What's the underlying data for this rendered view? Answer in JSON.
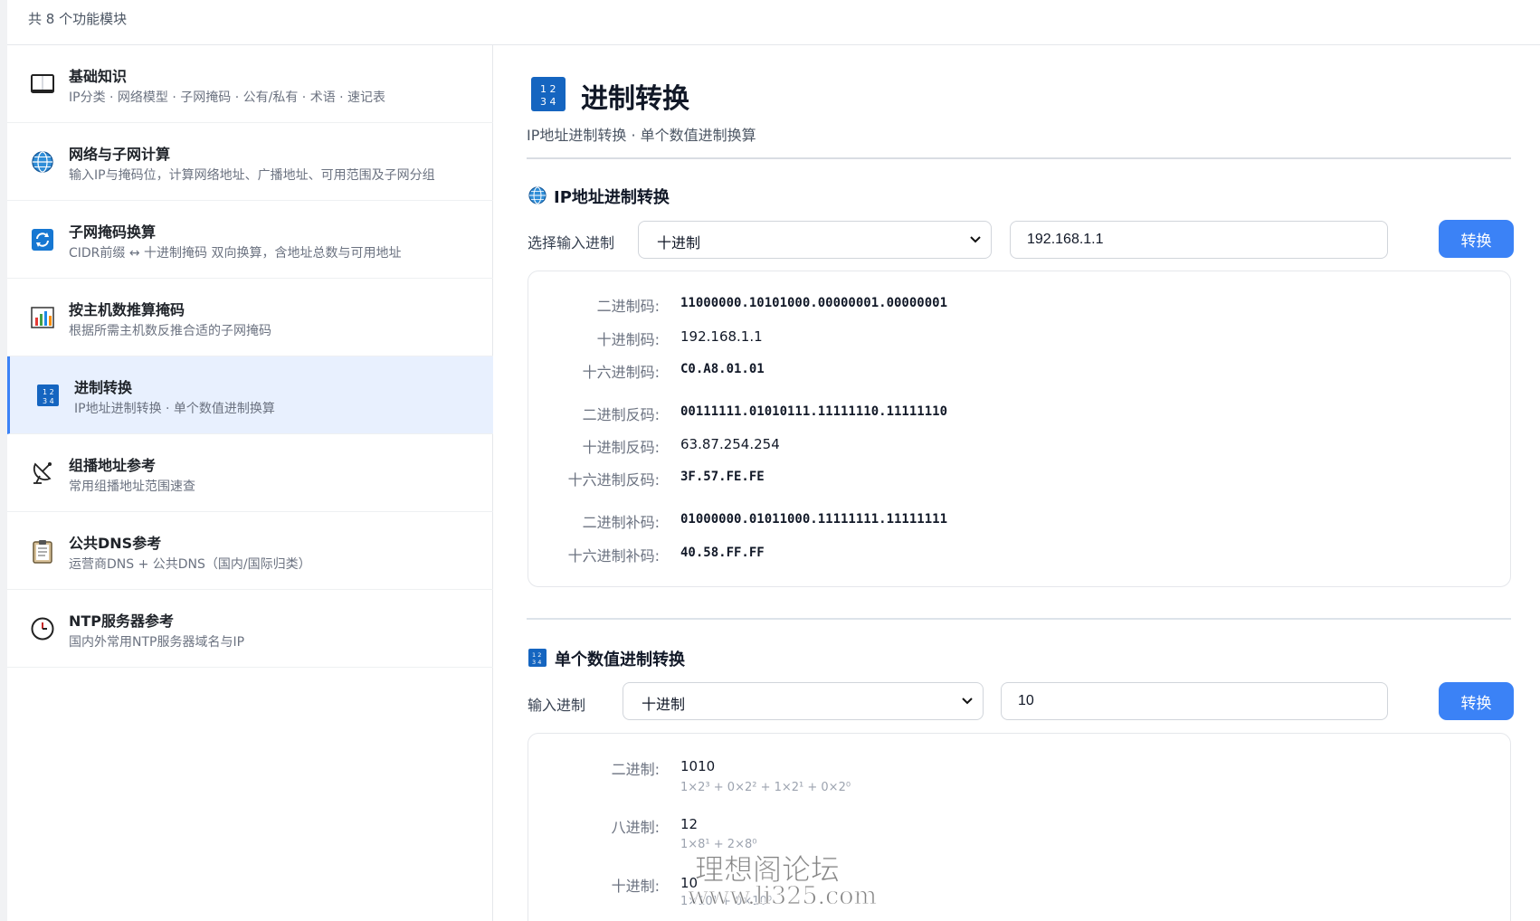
{
  "topbar": {
    "count": "共 8 个功能模块"
  },
  "sidebar": {
    "items": [
      {
        "title": "基础知识",
        "desc": "IP分类 · 网络模型 · 子网掩码 · 公有/私有 · 术语 · 速记表",
        "icon": "book-icon"
      },
      {
        "title": "网络与子网计算",
        "desc": "输入IP与掩码位，计算网络地址、广播地址、可用范围及子网分组",
        "icon": "globe-icon"
      },
      {
        "title": "子网掩码换算",
        "desc": "CIDR前缀 ↔ 十进制掩码 双向换算，含地址总数与可用地址",
        "icon": "refresh-icon"
      },
      {
        "title": "按主机数推算掩码",
        "desc": "根据所需主机数反推合适的子网掩码",
        "icon": "bar-chart-icon"
      },
      {
        "title": "进制转换",
        "desc": "IP地址进制转换 · 单个数值进制换算",
        "icon": "numbers-icon"
      },
      {
        "title": "组播地址参考",
        "desc": "常用组播地址范围速查",
        "icon": "satellite-icon"
      },
      {
        "title": "公共DNS参考",
        "desc": "运营商DNS + 公共DNS（国内/国际归类）",
        "icon": "clipboard-icon"
      },
      {
        "title": "NTP服务器参考",
        "desc": "国内外常用NTP服务器域名与IP",
        "icon": "clock-icon"
      }
    ]
  },
  "main": {
    "title": "进制转换",
    "subtitle": "IP地址进制转换 · 单个数值进制换算",
    "ip_section": {
      "title": "IP地址进制转换",
      "select_label": "选择输入进制",
      "select_value": "十进制",
      "input_value": "192.168.1.1",
      "button": "转换",
      "results": [
        {
          "label": "二进制码:",
          "value": "11000000.10101000.00000001.00000001"
        },
        {
          "label": "十进制码:",
          "value": "192.168.1.1"
        },
        {
          "label": "十六进制码:",
          "value": "C0.A8.01.01"
        },
        {
          "label": "二进制反码:",
          "value": "00111111.01010111.11111110.11111110"
        },
        {
          "label": "十进制反码:",
          "value": "63.87.254.254"
        },
        {
          "label": "十六进制反码:",
          "value": "3F.57.FE.FE"
        },
        {
          "label": "二进制补码:",
          "value": "01000000.01011000.11111111.11111111"
        },
        {
          "label": "十六进制补码:",
          "value": "40.58.FF.FF"
        }
      ]
    },
    "num_section": {
      "title": "单个数值进制转换",
      "select_label": "输入进制",
      "select_value": "十进制",
      "input_value": "10",
      "button": "转换",
      "results": [
        {
          "label": "二进制:",
          "value": "1010",
          "formula": "1×2³ + 0×2² + 1×2¹ + 0×2⁰"
        },
        {
          "label": "八进制:",
          "value": "12",
          "formula": "1×8¹ + 2×8⁰"
        },
        {
          "label": "十进制:",
          "value": "10",
          "formula": "1×10¹ + 0×10⁰"
        }
      ]
    }
  },
  "watermark": {
    "line1": "理想阁论坛",
    "line2": "www.li325.com"
  },
  "colors": {
    "accent": "#3b82f6",
    "active_bg": "#e8f0fe"
  }
}
